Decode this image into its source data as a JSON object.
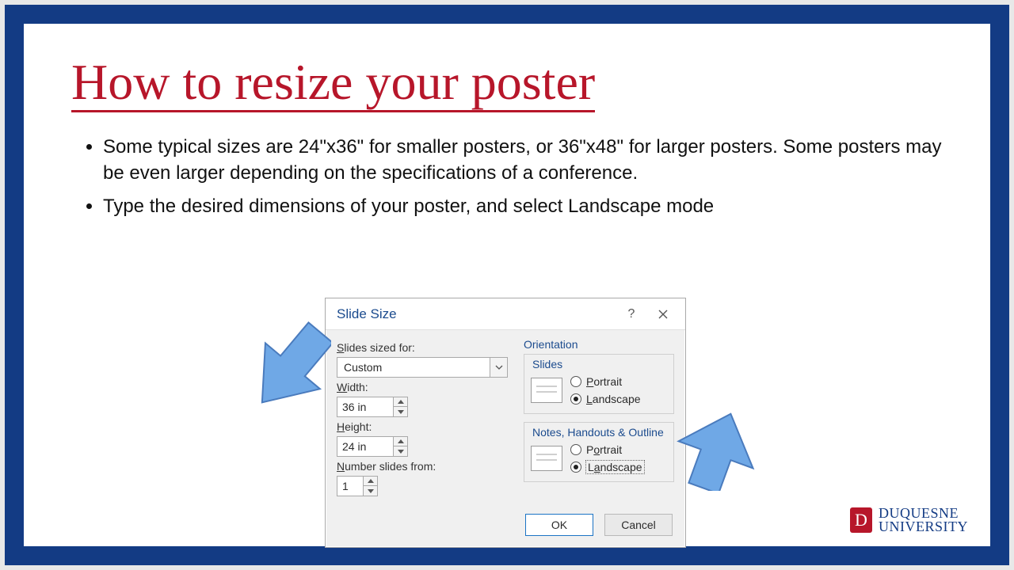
{
  "slide": {
    "title": "How to resize your poster",
    "bullets": [
      "Some typical sizes are 24\"x36\" for smaller posters, or 36\"x48\" for larger posters. Some posters may be even larger depending on the specifications of a conference.",
      "Type the desired dimensions of your poster, and select Landscape mode"
    ]
  },
  "dialog": {
    "title": "Slide Size",
    "help_symbol": "?",
    "labels": {
      "slides_sized_for": "Slides sized for:",
      "width": "Width:",
      "height": "Height:",
      "number_from": "Number slides from:",
      "orientation": "Orientation",
      "group_slides": "Slides",
      "group_notes": "Notes, Handouts & Outline",
      "portrait": "Portrait",
      "landscape": "Landscape"
    },
    "values": {
      "sized_for": "Custom",
      "width": "36 in",
      "height": "24 in",
      "number_from": "1"
    },
    "orientation": {
      "slides": "landscape",
      "notes": "landscape"
    },
    "buttons": {
      "ok": "OK",
      "cancel": "Cancel"
    }
  },
  "logo": {
    "badge": "D",
    "line1": "DUQUESNE",
    "line2": "UNIVERSITY"
  }
}
